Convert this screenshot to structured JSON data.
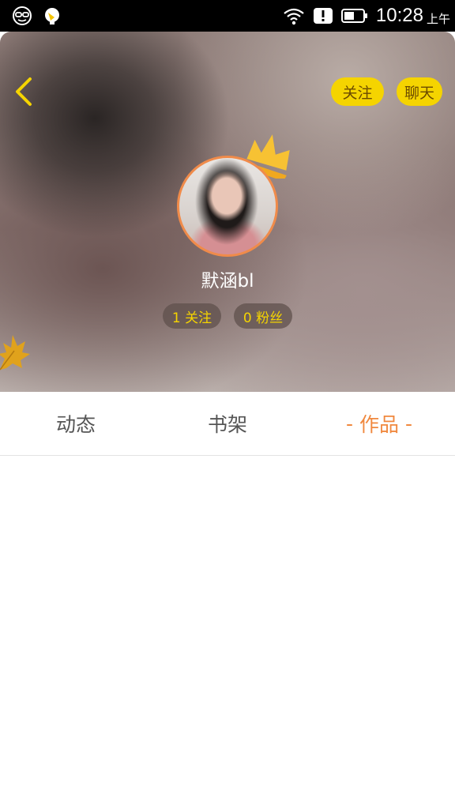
{
  "status_bar": {
    "time": "10:28",
    "ampm": "上午",
    "icons": [
      "smiley-glasses-icon",
      "bulb-notification-icon",
      "wifi-icon",
      "alert-icon",
      "battery-icon"
    ]
  },
  "header": {
    "back_icon": "chevron-left-icon",
    "follow_label": "关注",
    "chat_label": "聊天",
    "user_name": "默涵bl",
    "following_stat": "1 关注",
    "fans_stat": "0 粉丝"
  },
  "tabs": [
    {
      "label": "动态",
      "active": false
    },
    {
      "label": "书架",
      "active": false
    },
    {
      "label": "作品",
      "active": true,
      "decor": "-"
    }
  ],
  "colors": {
    "accent": "#f0883e",
    "pill_yellow": "#f5d400",
    "avatar_border": "#f08b4a"
  }
}
